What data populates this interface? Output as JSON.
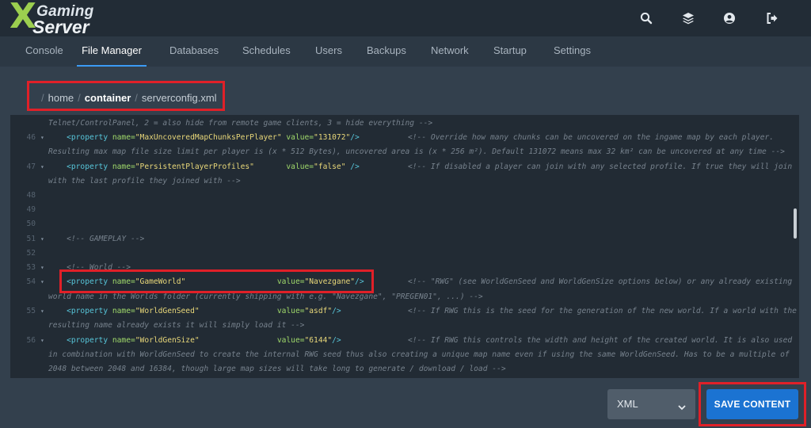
{
  "header": {
    "logo_x": "X",
    "logo_gaming": "Gaming",
    "logo_server": "Server",
    "icons": [
      "search-icon",
      "layers-icon",
      "account-icon",
      "logout-icon"
    ]
  },
  "nav": {
    "tabs": [
      "Console",
      "File Manager",
      "Databases",
      "Schedules",
      "Users",
      "Backups",
      "Network",
      "Startup",
      "Settings"
    ],
    "active": "File Manager"
  },
  "breadcrumb": {
    "separator": "/",
    "parts": [
      "home",
      "container",
      "serverconfig.xml"
    ]
  },
  "editor": {
    "lines": {
      "l0": {
        "num": "",
        "indent": "",
        "tag_open": "",
        "attr1": "",
        "val1": "",
        "attr2": "",
        "val2": "",
        "tag_close": "",
        "comment": "Telnet/ControlPanel, 2 = also hide from remote game clients, 3 = hide everything -->"
      },
      "l1": {
        "num": "46",
        "indent": "    ",
        "tag_open": "<property ",
        "attr1": "name=",
        "val1": "\"MaxUncoveredMapChunksPerPlayer\"",
        "pad": " ",
        "attr2": "value=",
        "val2": "\"131072\"",
        "tag_close": "/>",
        "comment": "<!-- Override how many chunks can be uncovered on the ingame map by each player."
      },
      "l2": {
        "num": "",
        "comment": "Resulting max map file size limit per player is (x * 512 Bytes), uncovered area is (x * 256 m²). Default 131072 means max 32 km² can be uncovered at any time -->"
      },
      "l3": {
        "num": "47",
        "indent": "    ",
        "tag_open": "<property ",
        "attr1": "name=",
        "val1": "\"PersistentPlayerProfiles\"",
        "pad": "       ",
        "attr2": "value=",
        "val2": "\"false\"",
        "tag_close": " />",
        "comment": "<!-- If disabled a player can join with any selected profile. If true they will join"
      },
      "l4": {
        "num": "",
        "comment": "with the last profile they joined with -->"
      },
      "l5": {
        "num": "48"
      },
      "l6": {
        "num": "49"
      },
      "l7": {
        "num": "50"
      },
      "l8": {
        "num": "51",
        "comment": "    <!-- GAMEPLAY -->"
      },
      "l9": {
        "num": "52"
      },
      "l10": {
        "num": "53",
        "comment": "    <!-- World -->"
      },
      "l11": {
        "num": "54",
        "indent": "    ",
        "tag_open": "<property ",
        "attr1": "name=",
        "val1": "\"GameWorld\"",
        "pad": "                    ",
        "attr2": "value=",
        "val2": "\"Navezgane\"",
        "tag_close": "/>",
        "comment": "<!-- \"RWG\" (see WorldGenSeed and WorldGenSize options below) or any already existing"
      },
      "l12": {
        "num": "",
        "comment": "world name in the Worlds folder (currently shipping with e.g. \"Navezgane\", \"PREGEN01\", ...) -->"
      },
      "l13": {
        "num": "55",
        "indent": "    ",
        "tag_open": "<property ",
        "attr1": "name=",
        "val1": "\"WorldGenSeed\"",
        "pad": "                 ",
        "attr2": "value=",
        "val2": "\"asdf\"",
        "tag_close": "/>",
        "comment": "<!-- If RWG this is the seed for the generation of the new world. If a world with the"
      },
      "l14": {
        "num": "",
        "comment": "resulting name already exists it will simply load it -->"
      },
      "l15": {
        "num": "56",
        "indent": "    ",
        "tag_open": "<property ",
        "attr1": "name=",
        "val1": "\"WorldGenSize\"",
        "pad": "                 ",
        "attr2": "value=",
        "val2": "\"6144\"",
        "tag_close": "/>",
        "comment": "<!-- If RWG this controls the width and height of the created world. It is also used"
      },
      "l16": {
        "num": "",
        "comment": "in combination with WorldGenSeed to create the internal RWG seed thus also creating a unique map name even if using the same WorldGenSeed. Has to be a multiple of"
      },
      "l17": {
        "num": "",
        "comment": "2048 between 2048 and 16384, though large map sizes will take long to generate / download / load -->"
      }
    }
  },
  "footer": {
    "language_select": "XML",
    "save_label": "SAVE CONTENT"
  },
  "colors": {
    "accent": "#1b73d2",
    "highlight_box": "#e02028",
    "active_tab_underline": "#3b9bf5"
  }
}
